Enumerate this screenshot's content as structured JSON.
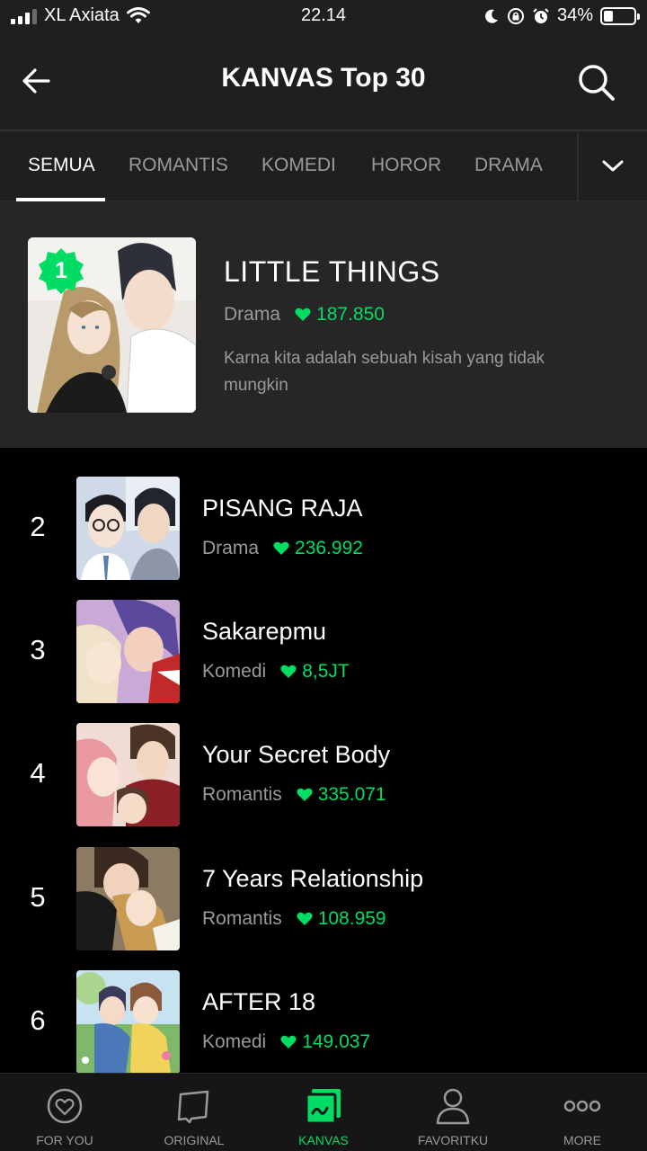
{
  "status_bar": {
    "carrier": "XL Axiata",
    "time": "22.14",
    "battery": "34%"
  },
  "header": {
    "title": "KANVAS Top 30"
  },
  "tabs": [
    {
      "label": "SEMUA",
      "active": true
    },
    {
      "label": "ROMANTIS",
      "active": false
    },
    {
      "label": "KOMEDI",
      "active": false
    },
    {
      "label": "HOROR",
      "active": false
    },
    {
      "label": "DRAMA",
      "active": false
    }
  ],
  "featured": {
    "rank": "1",
    "title": "LITTLE THINGS",
    "genre": "Drama",
    "likes": "187.850",
    "description": "Karna kita adalah sebuah kisah yang tidak mungkin"
  },
  "items": [
    {
      "rank": "2",
      "title": "PISANG RAJA",
      "genre": "Drama",
      "likes": "236.992"
    },
    {
      "rank": "3",
      "title": "Sakarepmu",
      "genre": "Komedi",
      "likes": "8,5JT"
    },
    {
      "rank": "4",
      "title": "Your Secret Body",
      "genre": "Romantis",
      "likes": "335.071"
    },
    {
      "rank": "5",
      "title": "7 Years Relationship",
      "genre": "Romantis",
      "likes": "108.959"
    },
    {
      "rank": "6",
      "title": "AFTER 18",
      "genre": "Komedi",
      "likes": "149.037"
    }
  ],
  "bottom_nav": [
    {
      "label": "FOR YOU",
      "icon": "heart-circle-icon",
      "active": false
    },
    {
      "label": "ORIGINAL",
      "icon": "original-icon",
      "active": false
    },
    {
      "label": "KANVAS",
      "icon": "kanvas-icon",
      "active": true
    },
    {
      "label": "FAVORITKU",
      "icon": "person-icon",
      "active": false
    },
    {
      "label": "MORE",
      "icon": "more-icon",
      "active": false
    }
  ],
  "colors": {
    "accent": "#00dc64",
    "header_bg": "#1f1f1f",
    "featured_bg": "#262626",
    "list_bg": "#000000"
  }
}
